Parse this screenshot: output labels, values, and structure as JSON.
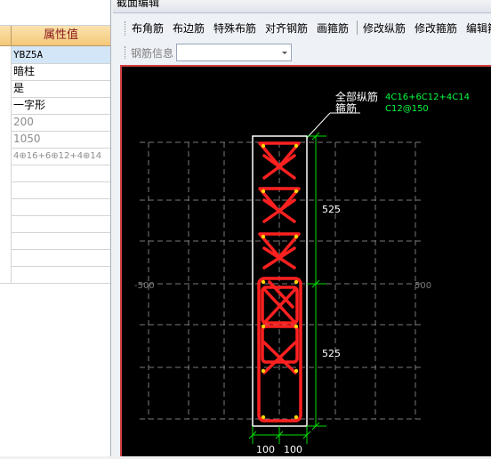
{
  "property_panel": {
    "header": "属性值",
    "rows": [
      {
        "value": "YBZ5A",
        "selected": true
      },
      {
        "value": "暗柱"
      },
      {
        "value": "是"
      },
      {
        "value": "一字形"
      },
      {
        "value": "200",
        "muted": true
      },
      {
        "value": "1050",
        "muted": true
      },
      {
        "value": "4⊕16+6⊕12+4⊕14",
        "muted": true
      },
      {
        "value": ""
      },
      {
        "value": ""
      },
      {
        "value": ""
      },
      {
        "value": ""
      },
      {
        "value": ""
      },
      {
        "value": ""
      },
      {
        "value": ""
      }
    ]
  },
  "window": {
    "title": "截面编辑",
    "toolbar": [
      "布角筋",
      "布边筋",
      "特殊布筋",
      "对齐钢筋",
      "画箍筋",
      "修改纵筋",
      "修改箍筋",
      "编辑箍"
    ],
    "rebar_info_label": "钢筋信息",
    "rebar_info_value": ""
  },
  "drawing": {
    "label_long": "全部纵筋",
    "label_stirrup": "箍筋",
    "value_long": "4C16+6C12+4C14",
    "value_stirrup": "C12@150",
    "dim_upper": "525",
    "dim_lower": "525",
    "dim_bottom_left": "100",
    "dim_bottom_right": "100",
    "axis_left": "-500",
    "axis_right": "500",
    "colors": {
      "background": "#000000",
      "rebar": "#ff2020",
      "dimension": "#00e000",
      "grid": "#7a7a7a",
      "outline": "#ffffff",
      "leader_text": "#00ff40"
    }
  }
}
